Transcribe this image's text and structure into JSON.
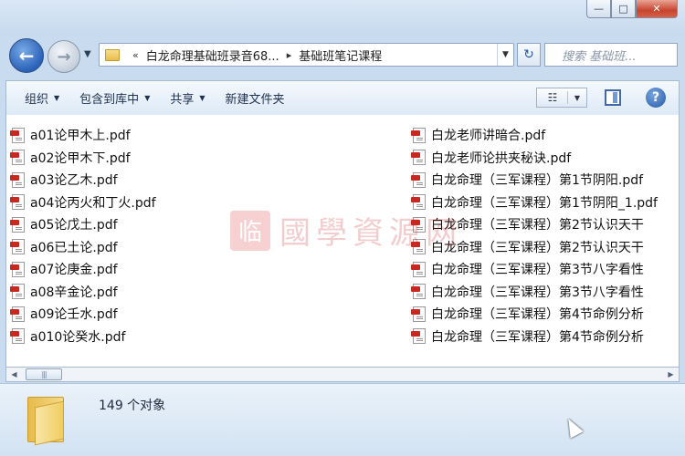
{
  "window": {
    "minimize_glyph": "—",
    "maximize_glyph": "□",
    "close_glyph": "✕"
  },
  "nav": {
    "back_glyph": "←",
    "forward_glyph": "→",
    "recent_glyph": "▼",
    "refresh_glyph": "↻"
  },
  "address": {
    "overflow": "«",
    "segments": [
      "白龙命理基础班录音68...",
      "基础班笔记课程"
    ],
    "separator": "▸",
    "dropdown_glyph": "▼"
  },
  "search": {
    "placeholder": "搜索 基础班..."
  },
  "toolbar": {
    "organize": "组织",
    "include_library": "包含到库中",
    "share": "共享",
    "new_folder": "新建文件夹",
    "caret": "▼",
    "view_glyph": "☷",
    "help_glyph": "?"
  },
  "files": {
    "left": [
      "a01论甲木上.pdf",
      "a02论甲木下.pdf",
      "a03论乙木.pdf",
      "a04论丙火和丁火.pdf",
      "a05论戊土.pdf",
      "a06已土论.pdf",
      "a07论庚金.pdf",
      "a08辛金论.pdf",
      "a09论壬水.pdf",
      "a010论癸水.pdf"
    ],
    "right": [
      "白龙老师讲暗合.pdf",
      "白龙老师论拱夹秘诀.pdf",
      "白龙命理（三军课程）第1节阴阳.pdf",
      "白龙命理（三军课程）第1节阴阳_1.pdf",
      "白龙命理（三军课程）第2节认识天干",
      "白龙命理（三军课程）第2节认识天干",
      "白龙命理（三军课程）第3节八字看性",
      "白龙命理（三军课程）第3节八字看性",
      "白龙命理（三军课程）第4节命例分析",
      "白龙命理（三军课程）第4节命例分析"
    ]
  },
  "watermark": {
    "seal": "临",
    "text": "國學資源网"
  },
  "scrollbar": {
    "left_glyph": "◀",
    "right_glyph": "▶",
    "thumb_grip": "|||"
  },
  "status": {
    "count": "149 个对象"
  }
}
